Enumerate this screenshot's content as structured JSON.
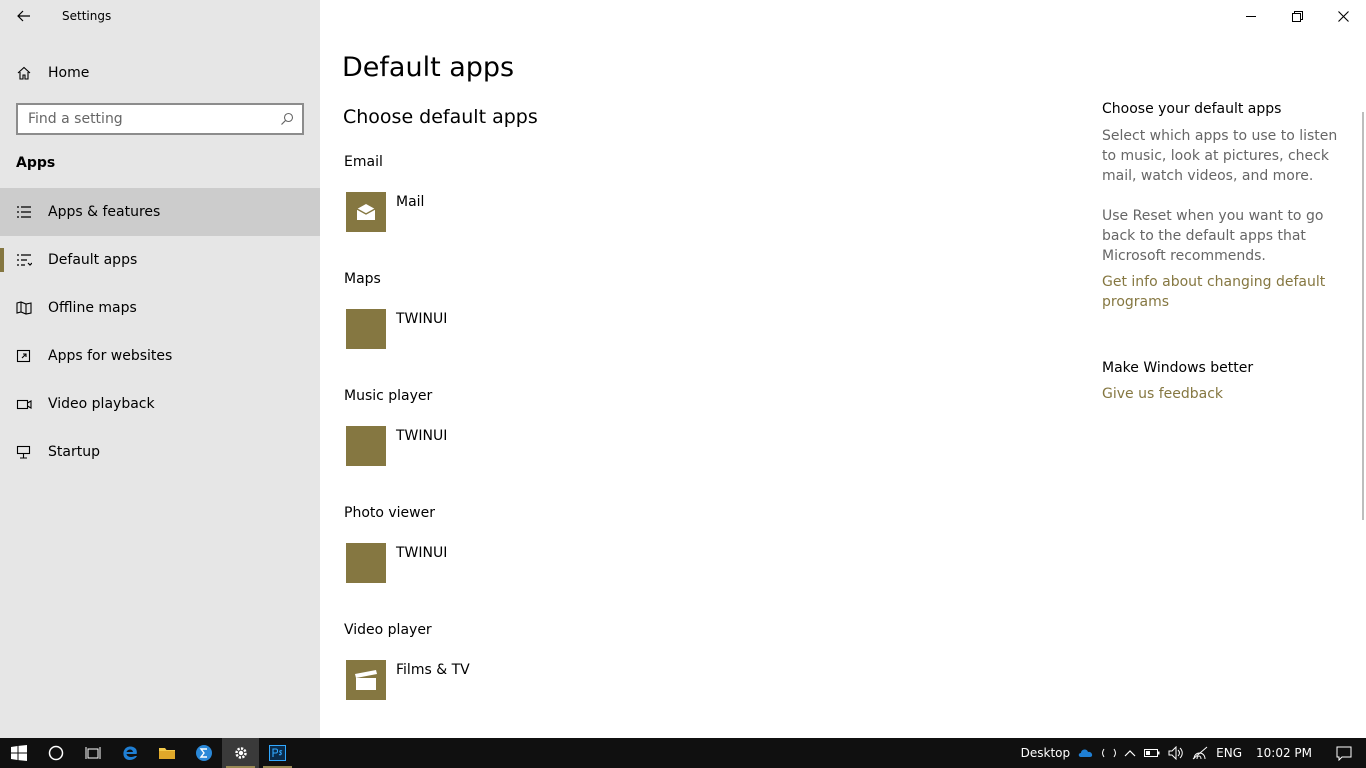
{
  "window": {
    "title": "Settings",
    "back_icon": "back-arrow-icon",
    "controls": [
      "minimize",
      "restore",
      "close"
    ]
  },
  "sidebar": {
    "home_label": "Home",
    "search_placeholder": "Find a setting",
    "section": "Apps",
    "items": [
      {
        "label": "Apps & features",
        "icon": "list-icon",
        "state": "hover"
      },
      {
        "label": "Default apps",
        "icon": "default-apps-icon",
        "state": "selected"
      },
      {
        "label": "Offline maps",
        "icon": "map-icon",
        "state": ""
      },
      {
        "label": "Apps for websites",
        "icon": "open-window-icon",
        "state": ""
      },
      {
        "label": "Video playback",
        "icon": "video-icon",
        "state": ""
      },
      {
        "label": "Startup",
        "icon": "startup-icon",
        "state": ""
      }
    ]
  },
  "main": {
    "title": "Default apps",
    "subtitle": "Choose default apps",
    "categories": [
      {
        "label": "Email",
        "app": "Mail",
        "icon": "mail-icon"
      },
      {
        "label": "Maps",
        "app": "TWINUI",
        "icon": ""
      },
      {
        "label": "Music player",
        "app": "TWINUI",
        "icon": ""
      },
      {
        "label": "Photo viewer",
        "app": "TWINUI",
        "icon": ""
      },
      {
        "label": "Video player",
        "app": "Films & TV",
        "icon": "clapperboard-icon"
      }
    ]
  },
  "right_panel": {
    "heading1": "Choose your default apps",
    "text1": "Select which apps to use to listen to music, look at pictures, check mail, watch videos, and more.",
    "text2": "Use Reset when you want to go back to the default apps that Microsoft recommends.",
    "link1": "Get info about changing default programs",
    "heading2": "Make Windows better",
    "link2": "Give us feedback"
  },
  "taskbar": {
    "desktop_label": "Desktop",
    "language": "ENG",
    "time": "10:02 PM"
  },
  "colors": {
    "accent": "#857741",
    "sidebar_bg": "#e6e6e6",
    "hover_bg": "#cccccc",
    "taskbar_bg": "#101010"
  }
}
